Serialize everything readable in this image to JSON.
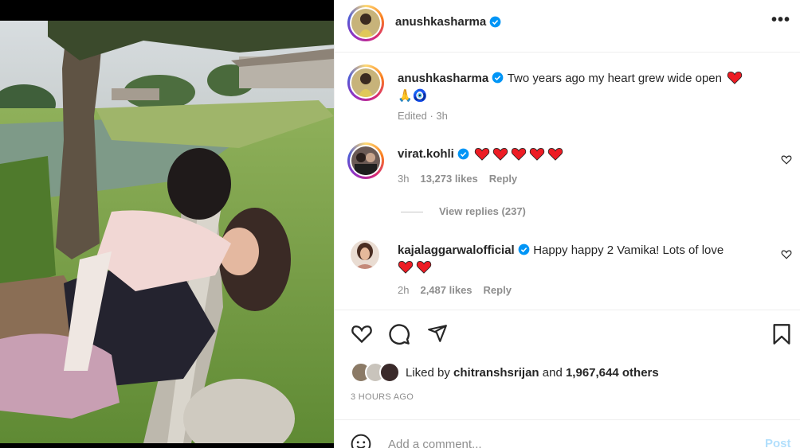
{
  "header": {
    "username": "anushkasharma",
    "more_label": "•••"
  },
  "caption": {
    "username": "anushkasharma",
    "text": "Two years ago my heart grew wide open",
    "emojis_line2": "🙏🧿",
    "meta": "Edited · 3h"
  },
  "comments": [
    {
      "username": "virat.kohli",
      "text": "",
      "hearts": 5,
      "time": "3h",
      "likes": "13,273 likes",
      "reply": "Reply"
    },
    {
      "username": "kajalaggarwalofficial",
      "text": "Happy happy 2 Vamika! Lots of love",
      "hearts": 2,
      "time": "2h",
      "likes": "2,487 likes",
      "reply": "Reply"
    }
  ],
  "view_replies": "View replies (237)",
  "likes_summary": {
    "prefix": "Liked by",
    "user": "chitranshsrijan",
    "connector": "and",
    "count": "1,967,644 others"
  },
  "time_ago": "3 HOURS AGO",
  "comment_box": {
    "placeholder": "Add a comment...",
    "post_label": "Post"
  },
  "colors": {
    "verified": "#0095f6",
    "heart_red": "#ed1c24",
    "post_disabled": "#b2dffc"
  },
  "icons": [
    "like-icon",
    "comment-icon",
    "share-icon",
    "save-icon",
    "emoji-icon",
    "verified-icon",
    "more-icon"
  ]
}
